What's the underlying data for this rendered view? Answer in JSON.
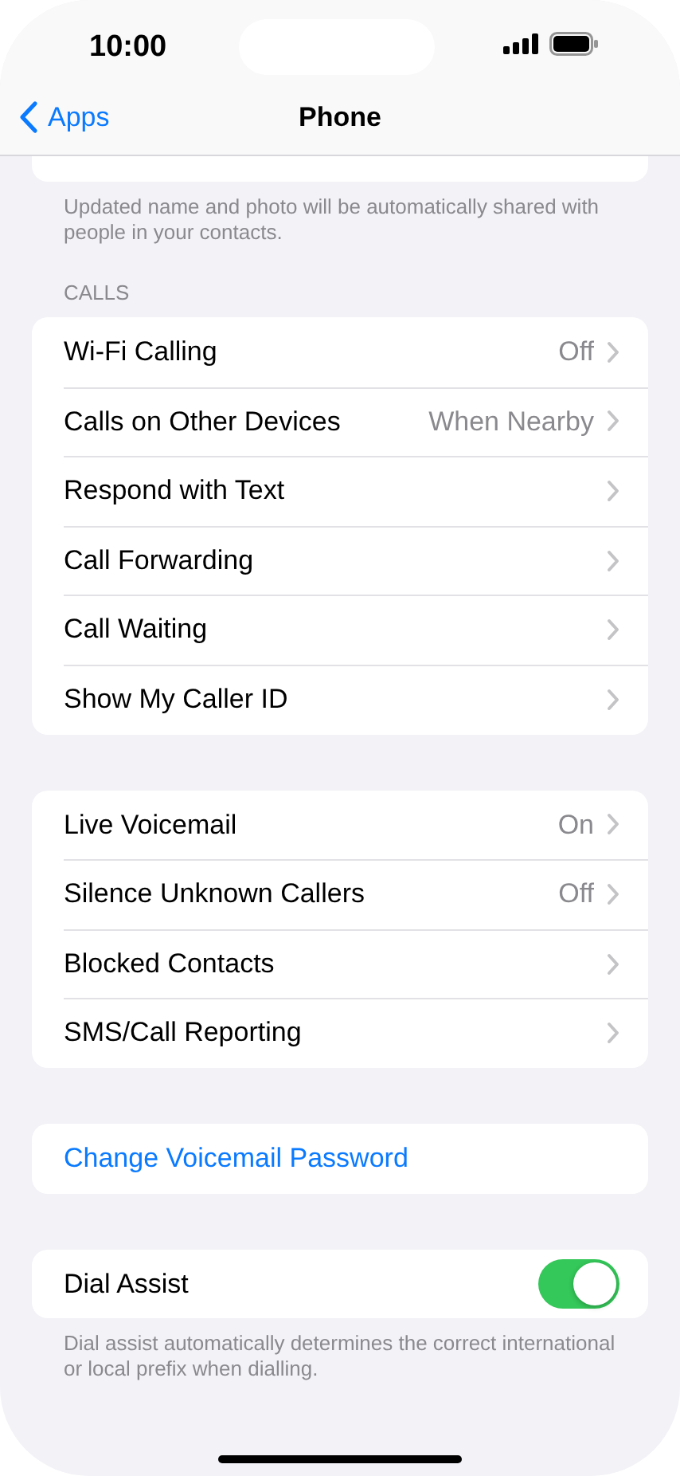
{
  "status_bar": {
    "time": "10:00"
  },
  "nav": {
    "back": "Apps",
    "title": "Phone"
  },
  "top_footer": "Updated name and photo will be automatically shared with people in your contacts.",
  "sections": [
    {
      "header": "CALLS",
      "rows": [
        {
          "kind": "link",
          "label": "Wi-Fi Calling",
          "value": "Off"
        },
        {
          "kind": "link",
          "label": "Calls on Other Devices",
          "value": "When Nearby"
        },
        {
          "kind": "link",
          "label": "Respond with Text"
        },
        {
          "kind": "link",
          "label": "Call Forwarding"
        },
        {
          "kind": "link",
          "label": "Call Waiting"
        },
        {
          "kind": "link",
          "label": "Show My Caller ID"
        }
      ]
    },
    {
      "rows": [
        {
          "kind": "link",
          "label": "Live Voicemail",
          "value": "On"
        },
        {
          "kind": "link",
          "label": "Silence Unknown Callers",
          "value": "Off"
        },
        {
          "kind": "link",
          "label": "Blocked Contacts"
        },
        {
          "kind": "link",
          "label": "SMS/Call Reporting"
        }
      ]
    },
    {
      "rows": [
        {
          "kind": "action",
          "label": "Change Voicemail Password"
        }
      ]
    },
    {
      "rows": [
        {
          "kind": "toggle",
          "label": "Dial Assist",
          "on": true
        }
      ],
      "footer": "Dial assist automatically determines the correct international or local prefix when dialling."
    }
  ]
}
